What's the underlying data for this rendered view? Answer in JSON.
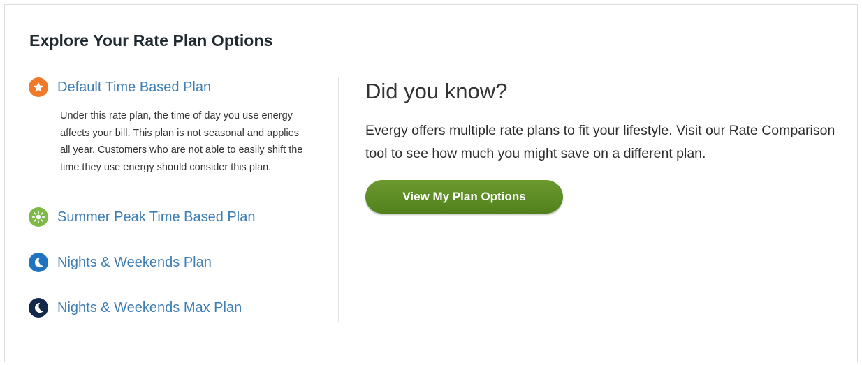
{
  "heading": "Explore Your Rate Plan Options",
  "plans": [
    {
      "label": "Default Time Based Plan",
      "icon": "star-icon",
      "color": "#f07a2a",
      "description": "Under this rate plan, the time of day you use energy affects your bill. This plan is not seasonal and applies all year. Customers who are not able to easily shift the time they use energy should consider this plan."
    },
    {
      "label": "Summer Peak Time Based Plan",
      "icon": "sun-icon",
      "color": "#7fba48"
    },
    {
      "label": "Nights & Weekends Plan",
      "icon": "moon-icon",
      "color": "#1f73c1"
    },
    {
      "label": "Nights & Weekends Max Plan",
      "icon": "moon-star-icon",
      "color": "#13284a"
    }
  ],
  "did_you_know": {
    "title": "Did you know?",
    "body": "Evergy offers multiple rate plans to fit your lifestyle. Visit our Rate Comparison tool to see how much you might save on a different plan.",
    "button_label": "View My Plan Options",
    "button_color": "#5f8d27"
  }
}
